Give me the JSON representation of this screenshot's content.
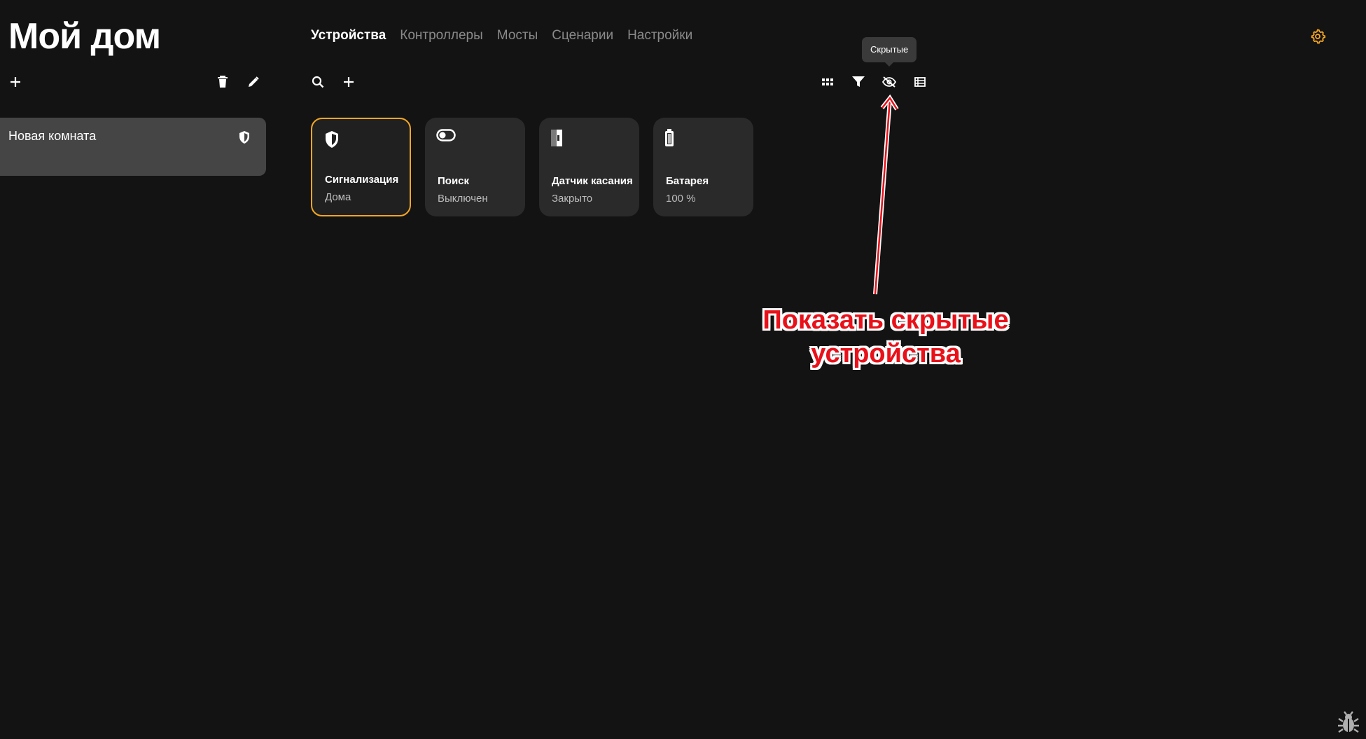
{
  "header": {
    "title": "Мой дом"
  },
  "tabs": [
    {
      "label": "Устройства",
      "active": true
    },
    {
      "label": "Контроллеры",
      "active": false
    },
    {
      "label": "Мосты",
      "active": false
    },
    {
      "label": "Сценарии",
      "active": false
    },
    {
      "label": "Настройки",
      "active": false
    }
  ],
  "rooms_toolbar": {
    "icons": [
      "plus-icon",
      "trash-icon",
      "pencil-icon"
    ]
  },
  "rooms": [
    {
      "name": "Новая комната",
      "icon": "shield-icon"
    }
  ],
  "devices_toolbar": {
    "left_icons": [
      "search-icon",
      "plus-icon"
    ],
    "right_icons": [
      "grid-icon",
      "filter-icon",
      "eye-off-icon",
      "list-icon"
    ],
    "tooltip": "Скрытые"
  },
  "devices": [
    {
      "name": "Сигнализация",
      "state": "Дома",
      "icon": "shield-icon",
      "selected": true
    },
    {
      "name": "Поиск",
      "state": "Выключен",
      "icon": "toggle-icon",
      "selected": false
    },
    {
      "name": "Датчик касания",
      "state": "Закрыто",
      "icon": "door-sensor-icon",
      "selected": false
    },
    {
      "name": "Батарея",
      "state": "100 %",
      "icon": "battery-icon",
      "selected": false
    }
  ],
  "annotation": {
    "line1": "Показать скрытые",
    "line2": "устройства"
  },
  "colors": {
    "background": "#131313",
    "accent": "#f5a623",
    "card": "#2a2a2a",
    "annotation": "#e8111a"
  }
}
